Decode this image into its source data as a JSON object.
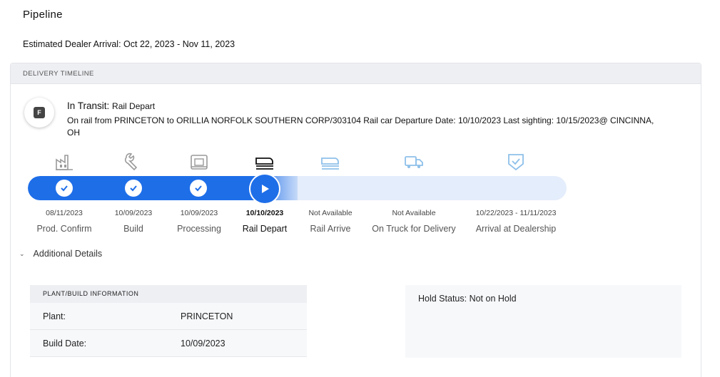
{
  "page": {
    "title": "Pipeline",
    "eta": "Estimated Dealer Arrival: Oct 22, 2023 - Nov 11, 2023"
  },
  "timeline": {
    "header": "DELIVERY TIMELINE",
    "status_badge": "F",
    "status_label": "In Transit:",
    "status_sub": "Rail Depart",
    "status_description": "On rail from PRINCETON to ORILLIA NORFOLK SOUTHERN CORP/303104 Rail car Departure Date: 10/10/2023 Last sighting: 10/15/2023@ CINCINNA, OH",
    "progress_completed_stages": 4,
    "progress_total_stages": 7,
    "colors": {
      "accent": "#1e6ee8",
      "track": "#e4edfb",
      "icon_done": "#9a9a9a",
      "icon_pending": "#8ec0ea"
    },
    "stages": [
      {
        "label": "Prod. Confirm",
        "date": "08/11/2023",
        "icon": "factory-icon",
        "state": "complete"
      },
      {
        "label": "Build",
        "date": "10/09/2023",
        "icon": "wrench-icon",
        "state": "complete"
      },
      {
        "label": "Processing",
        "date": "10/09/2023",
        "icon": "processing-icon",
        "state": "complete"
      },
      {
        "label": "Rail Depart",
        "date": "10/10/2023",
        "icon": "rail-icon",
        "state": "current"
      },
      {
        "label": "Rail Arrive",
        "date": "Not Available",
        "icon": "rail-arrive-icon",
        "state": "pending"
      },
      {
        "label": "On Truck for Delivery",
        "date": "Not Available",
        "icon": "truck-icon",
        "state": "pending"
      },
      {
        "label": "Arrival at Dealership",
        "date": "10/22/2023 - 11/11/2023",
        "icon": "dealership-shield-icon",
        "state": "pending"
      }
    ]
  },
  "details": {
    "toggle_label": "Additional Details",
    "plant_info": {
      "header": "PLANT/BUILD INFORMATION",
      "rows": [
        {
          "key": "Plant:",
          "value": "PRINCETON"
        },
        {
          "key": "Build Date:",
          "value": "10/09/2023"
        }
      ]
    },
    "hold_status": "Hold Status: Not on Hold"
  }
}
